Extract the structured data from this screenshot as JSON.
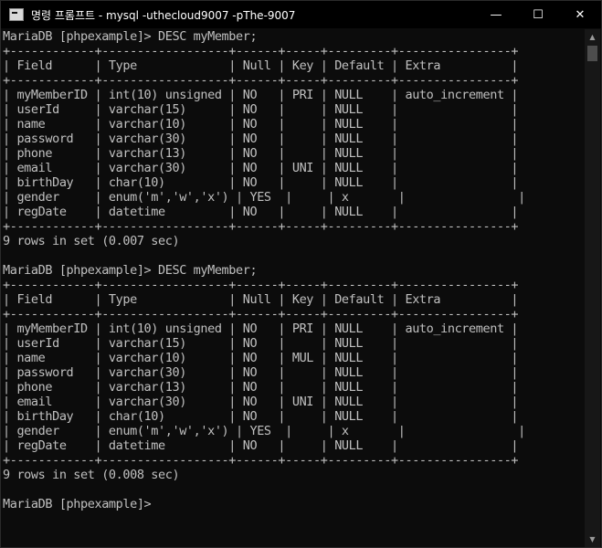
{
  "window": {
    "title": "명령 프롬프트 - mysql  -uthecloud9007 -pThe-9007",
    "icon": "cmd-icon",
    "minimize_glyph": "—",
    "maximize_glyph": "☐",
    "close_glyph": "✕"
  },
  "scrollbar": {
    "up_glyph": "▲",
    "down_glyph": "▼"
  },
  "terminal": {
    "lines": [
      "MariaDB [phpexample]> DESC myMember;",
      "+------------+------------------+------+-----+---------+----------------+",
      "| Field      | Type             | Null | Key | Default | Extra          |",
      "+------------+------------------+------+-----+---------+----------------+",
      "| myMemberID | int(10) unsigned | NO   | PRI | NULL    | auto_increment |",
      "| userId     | varchar(15)      | NO   |     | NULL    |                |",
      "| name       | varchar(10)      | NO   |     | NULL    |                |",
      "| password   | varchar(30)      | NO   |     | NULL    |                |",
      "| phone      | varchar(13)      | NO   |     | NULL    |                |",
      "| email      | varchar(30)      | NO   | UNI | NULL    |                |",
      "| birthDay   | char(10)         | NO   |     | NULL    |                |",
      "| gender     | enum('m','w','x') | YES  |     | x       |                |",
      "| regDate    | datetime         | NO   |     | NULL    |                |",
      "+------------+------------------+------+-----+---------+----------------+",
      "9 rows in set (0.007 sec)",
      "",
      "MariaDB [phpexample]> DESC myMember;",
      "+------------+------------------+------+-----+---------+----------------+",
      "| Field      | Type             | Null | Key | Default | Extra          |",
      "+------------+------------------+------+-----+---------+----------------+",
      "| myMemberID | int(10) unsigned | NO   | PRI | NULL    | auto_increment |",
      "| userId     | varchar(15)      | NO   |     | NULL    |                |",
      "| name       | varchar(10)      | NO   | MUL | NULL    |                |",
      "| password   | varchar(30)      | NO   |     | NULL    |                |",
      "| phone      | varchar(13)      | NO   |     | NULL    |                |",
      "| email      | varchar(30)      | NO   | UNI | NULL    |                |",
      "| birthDay   | char(10)         | NO   |     | NULL    |                |",
      "| gender     | enum('m','w','x') | YES  |     | x       |                |",
      "| regDate    | datetime         | NO   |     | NULL    |                |",
      "+------------+------------------+------+-----+---------+----------------+",
      "9 rows in set (0.008 sec)",
      "",
      "MariaDB [phpexample]>"
    ]
  },
  "colors": {
    "background": "#0c0c0c",
    "text": "#c0c0c0",
    "titlebar": "#000000"
  }
}
